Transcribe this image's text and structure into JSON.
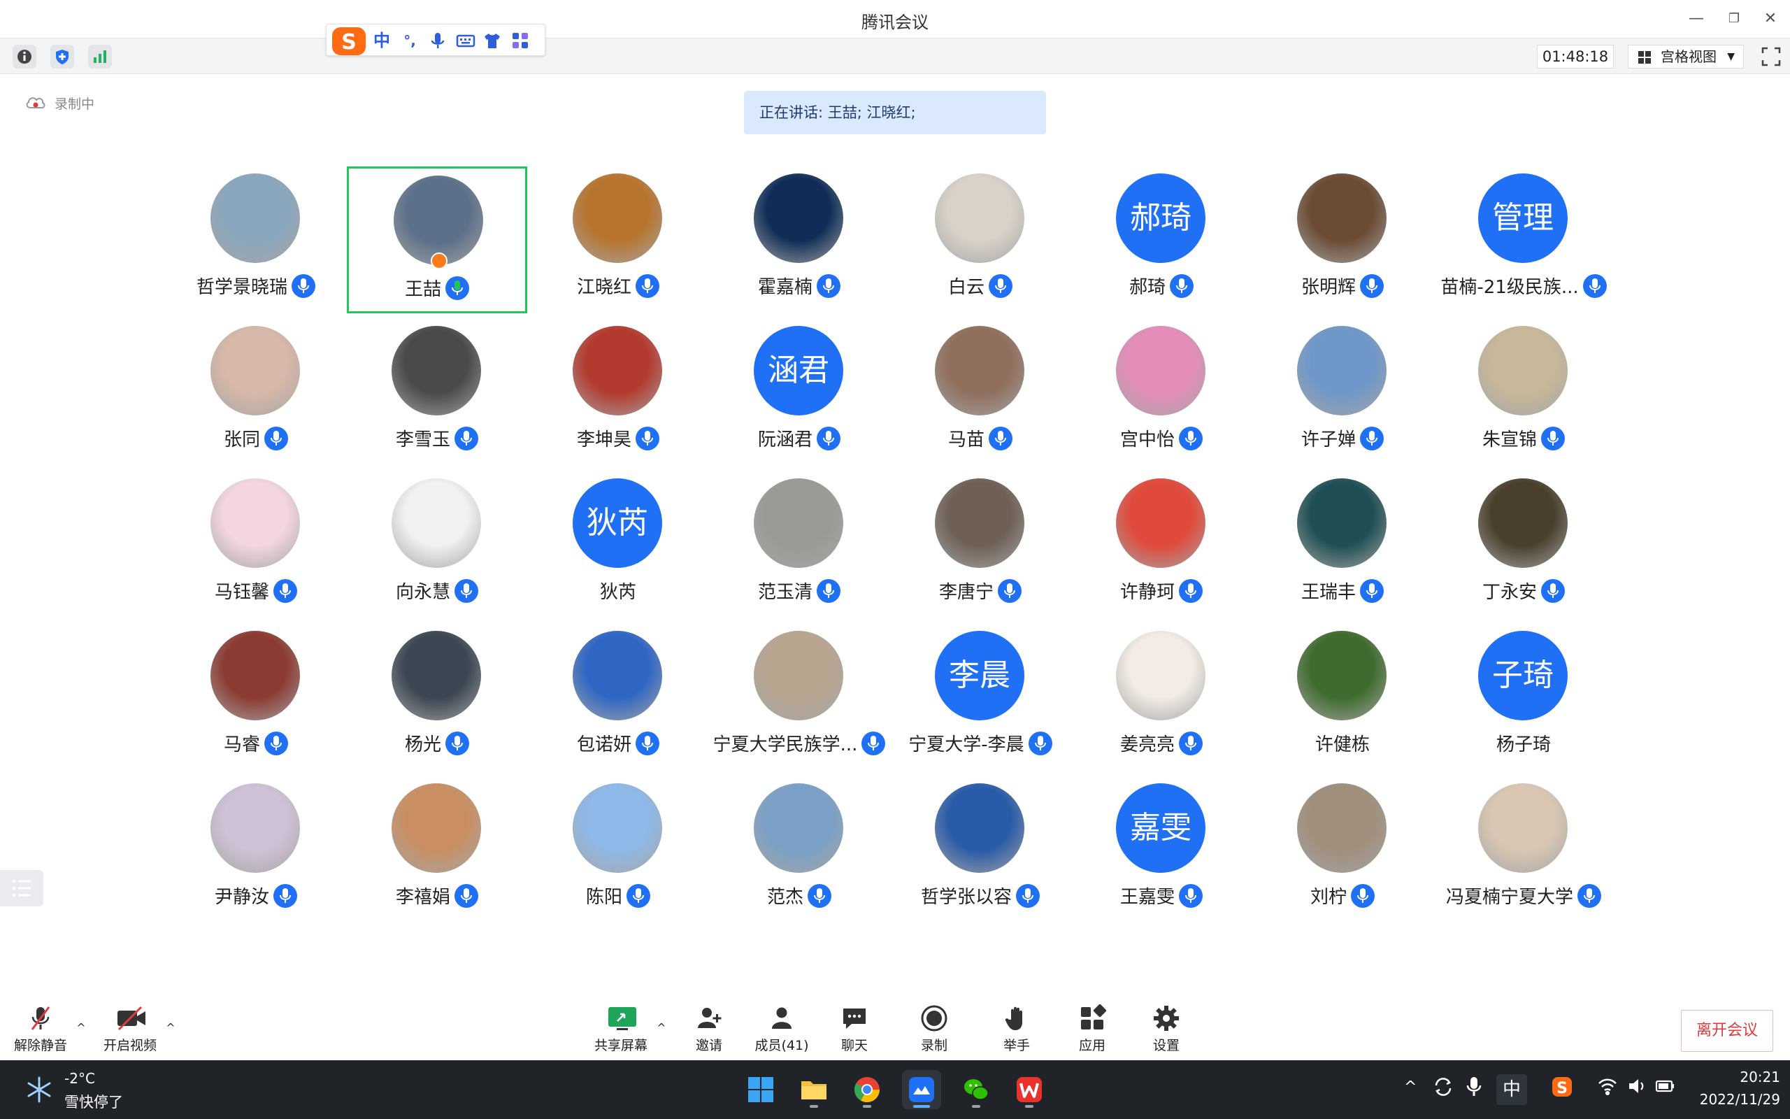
{
  "window": {
    "title": "腾讯会议",
    "minimize": "—",
    "restore": "❐",
    "close": "✕"
  },
  "toolbar": {
    "timer": "01:48:18",
    "view_mode": "宫格视图",
    "dropdown": "▼"
  },
  "ime": {
    "mode": "中",
    "punct": "°,"
  },
  "recording": {
    "label": "录制中"
  },
  "speaking": {
    "text": "正在讲话: 王喆; 江晓红;"
  },
  "participants": [
    {
      "name": "哲学景晓瑞",
      "avatar": "photo",
      "mic": true,
      "color": "#8aa6bd"
    },
    {
      "name": "王喆",
      "avatar": "photo",
      "mic": true,
      "speaking": true,
      "host": true,
      "color": "#5d7089"
    },
    {
      "name": "江晓红",
      "avatar": "photo",
      "mic": true,
      "color": "#b8742e"
    },
    {
      "name": "霍嘉楠",
      "avatar": "photo",
      "mic": true,
      "color": "#0f2d57"
    },
    {
      "name": "白云",
      "avatar": "photo",
      "mic": true,
      "color": "#d9d2c8"
    },
    {
      "name": "郝琦",
      "avatar": "text",
      "avatar_text": "郝琦",
      "mic": true
    },
    {
      "name": "张明辉",
      "avatar": "photo",
      "mic": true,
      "color": "#6b4b34"
    },
    {
      "name": "苗楠-21级民族...",
      "avatar": "text",
      "avatar_text": "管理",
      "mic": true
    },
    {
      "name": "张同",
      "avatar": "photo",
      "mic": true,
      "color": "#d8b8a8"
    },
    {
      "name": "李雪玉",
      "avatar": "photo",
      "mic": true,
      "color": "#4a4a4a"
    },
    {
      "name": "李坤昊",
      "avatar": "photo",
      "mic": true,
      "color": "#b33a2e"
    },
    {
      "name": "阮涵君",
      "avatar": "text",
      "avatar_text": "涵君",
      "mic": true
    },
    {
      "name": "马苗",
      "avatar": "photo",
      "mic": true,
      "color": "#8f6e5c"
    },
    {
      "name": "宫中怡",
      "avatar": "photo",
      "mic": true,
      "color": "#e58cb9"
    },
    {
      "name": "许子婵",
      "avatar": "photo",
      "mic": true,
      "color": "#6e97c9"
    },
    {
      "name": "朱宣锦",
      "avatar": "photo",
      "mic": true,
      "color": "#c8b89a"
    },
    {
      "name": "马钰馨",
      "avatar": "photo",
      "mic": true,
      "color": "#f4d6e1"
    },
    {
      "name": "向永慧",
      "avatar": "photo",
      "mic": true,
      "color": "#f1f1f1"
    },
    {
      "name": "狄芮",
      "avatar": "text",
      "avatar_text": "狄芮",
      "mic": false
    },
    {
      "name": "范玉清",
      "avatar": "photo",
      "mic": true,
      "color": "#9a9a95"
    },
    {
      "name": "李唐宁",
      "avatar": "photo",
      "mic": true,
      "color": "#6f6056"
    },
    {
      "name": "许静珂",
      "avatar": "photo",
      "mic": true,
      "color": "#e04a3c"
    },
    {
      "name": "王瑞丰",
      "avatar": "photo",
      "mic": true,
      "color": "#1f4f54"
    },
    {
      "name": "丁永安",
      "avatar": "photo",
      "mic": true,
      "color": "#4a3f2c"
    },
    {
      "name": "马睿",
      "avatar": "photo",
      "mic": true,
      "color": "#8c3b33"
    },
    {
      "name": "杨光",
      "avatar": "photo",
      "mic": true,
      "color": "#3b4652"
    },
    {
      "name": "包诺妍",
      "avatar": "photo",
      "mic": true,
      "color": "#2f66c4"
    },
    {
      "name": "宁夏大学民族学...",
      "avatar": "photo",
      "mic": true,
      "color": "#b8a590"
    },
    {
      "name": "宁夏大学-李晨",
      "avatar": "text",
      "avatar_text": "李晨",
      "mic": true
    },
    {
      "name": "姜亮亮",
      "avatar": "photo",
      "mic": true,
      "color": "#f2ece4"
    },
    {
      "name": "许健栋",
      "avatar": "photo",
      "mic": false,
      "color": "#3f6b2e"
    },
    {
      "name": "杨子琦",
      "avatar": "text",
      "avatar_text": "子琦",
      "mic": false
    },
    {
      "name": "尹静汝",
      "avatar": "photo",
      "mic": true,
      "color": "#cfc1d6"
    },
    {
      "name": "李禧娟",
      "avatar": "photo",
      "mic": true,
      "color": "#c98f63"
    },
    {
      "name": "陈阳",
      "avatar": "photo",
      "mic": true,
      "color": "#8fb9e8"
    },
    {
      "name": "范杰",
      "avatar": "photo",
      "mic": true,
      "color": "#7aa0c7"
    },
    {
      "name": "哲学张以容",
      "avatar": "photo",
      "mic": true,
      "color": "#2a5ba8"
    },
    {
      "name": "王嘉雯",
      "avatar": "text",
      "avatar_text": "嘉雯",
      "mic": true
    },
    {
      "name": "刘柠",
      "avatar": "photo",
      "mic": true,
      "color": "#a08e7c"
    },
    {
      "name": "冯夏楠宁夏大学",
      "avatar": "photo",
      "mic": true,
      "color": "#d9c7b3"
    }
  ],
  "controls": {
    "unmute": "解除静音",
    "start_video": "开启视频",
    "share_screen": "共享屏幕",
    "invite": "邀请",
    "members": "成员(41)",
    "chat": "聊天",
    "record": "录制",
    "raise_hand": "举手",
    "apps": "应用",
    "settings": "设置",
    "leave": "离开会议",
    "caret": "^"
  },
  "taskbar": {
    "temperature": "-2°C",
    "weather": "雪快停了",
    "ime_mode": "中",
    "time": "20:21",
    "date": "2022/11/29",
    "tray_up": "^"
  },
  "colors": {
    "accent": "#1f70f5",
    "speaking_border": "#22c55e",
    "leave": "#e03b3b",
    "taskbar": "#202429"
  }
}
